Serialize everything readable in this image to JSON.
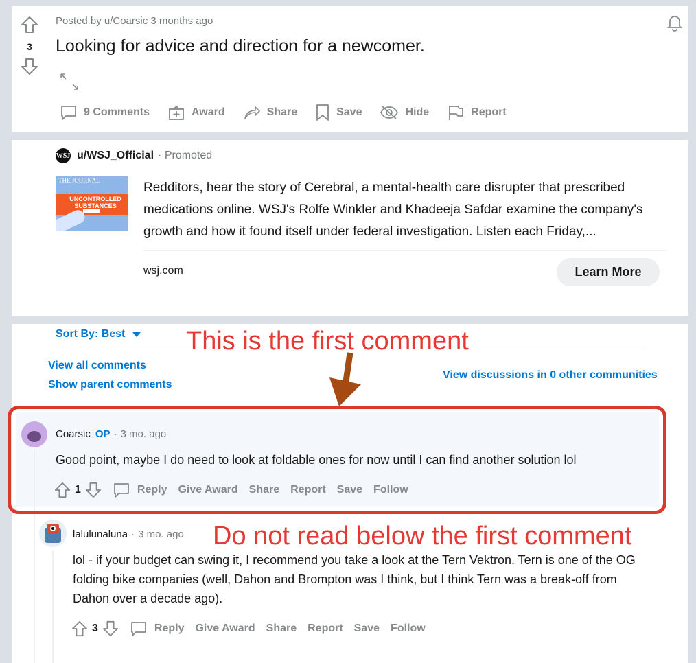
{
  "post": {
    "vote_count": "3",
    "meta": "Posted by u/Coarsic 3 months ago",
    "title": "Looking for advice and direction for a newcomer.",
    "actions": {
      "comments": "9 Comments",
      "award": "Award",
      "share": "Share",
      "save": "Save",
      "hide": "Hide",
      "report": "Report"
    }
  },
  "promo": {
    "logo_text": "WSJ",
    "user": "u/WSJ_Official",
    "tag": "Promoted",
    "thumb_title": "THE JOURNAL",
    "thumb_band": "UNCONTROLLED SUBSTANCES",
    "text": "Redditors, hear the story of Cerebral, a mental-health care disrupter that prescribed medications online. WSJ's Rolfe Winkler and Khadeeja Safdar examine the company's growth and how it found itself under federal investigation. Listen each Friday,...",
    "domain": "wsj.com",
    "cta": "Learn More"
  },
  "comments_panel": {
    "sort_label": "Sort By: Best",
    "view_all": "View all comments",
    "show_parent": "Show parent comments",
    "view_discussions": "View discussions in 0 other communities"
  },
  "comments": [
    {
      "author": "Coarsic",
      "op_badge": "OP",
      "time": "3 mo. ago",
      "body": "Good point, maybe I do need to look at foldable ones for now until I can find another solution lol",
      "votes": "1",
      "actions": [
        "Reply",
        "Give Award",
        "Share",
        "Report",
        "Save",
        "Follow"
      ]
    },
    {
      "author": "lalulunaluna",
      "time": "3 mo. ago",
      "body": "lol - if your budget can swing it, I recommend you take a look at the Tern Vektron. Tern is one of the OG folding bike companies (well, Dahon and Brompton was I think, but I think Tern was a break-off from Dahon over a decade ago).",
      "votes": "3",
      "actions": [
        "Reply",
        "Give Award",
        "Share",
        "Report",
        "Save",
        "Follow"
      ]
    }
  ],
  "annotations": {
    "first": "This is the first comment",
    "second": "Do not read below the first comment"
  },
  "colors": {
    "accent_blue": "#0079d3",
    "annotation_red": "#e53935",
    "highlight_border": "#d93a2b",
    "arrow": "#a64a14"
  }
}
